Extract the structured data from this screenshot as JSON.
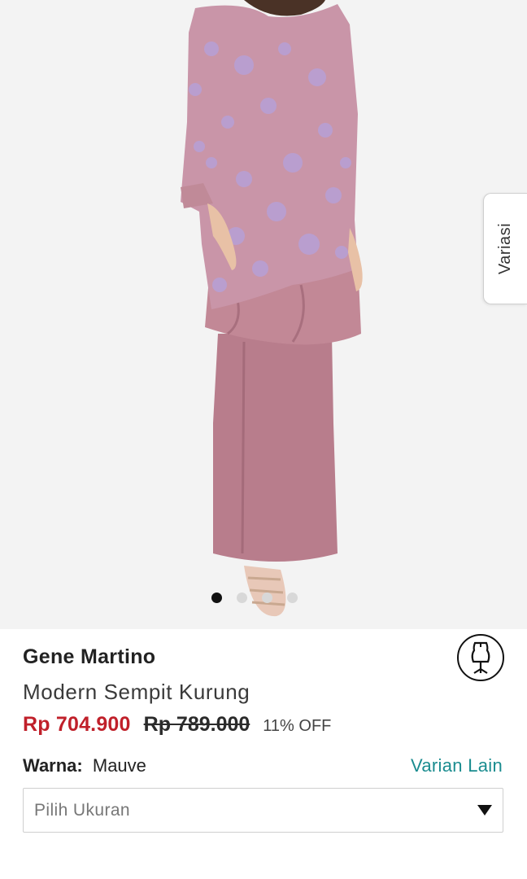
{
  "gallery": {
    "image_icon": "model-kurung-photo",
    "dots": 4,
    "active_index": 0
  },
  "variasi_tab": {
    "label": "Variasi"
  },
  "product": {
    "brand": "Gene Martino",
    "name": "Modern Sempit Kurung",
    "price_current": "Rp 704.900",
    "price_original": "Rp 789.000",
    "discount": "11% OFF",
    "color_label": "Warna:",
    "color_value": "Mauve",
    "other_variants_link": "Varian Lain",
    "size_placeholder": "Pilih Ukuran",
    "size_guide_icon": "dress-form-icon"
  },
  "colors": {
    "price_red": "#c0202a",
    "link_teal": "#1a8c8f",
    "hero_bg": "#f3f3f3"
  }
}
